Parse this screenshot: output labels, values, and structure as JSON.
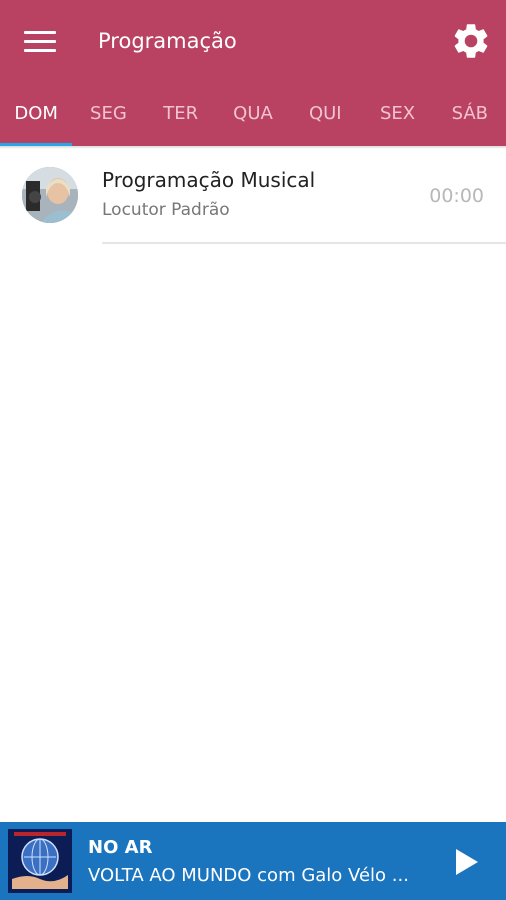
{
  "appbar": {
    "title": "Programação",
    "menu_icon": "menu-icon",
    "settings_icon": "gear-icon"
  },
  "tabs": [
    {
      "label": "DOM",
      "active": true
    },
    {
      "label": "SEG"
    },
    {
      "label": "TER"
    },
    {
      "label": "QUA"
    },
    {
      "label": "QUI"
    },
    {
      "label": "SEX"
    },
    {
      "label": "SÁB"
    }
  ],
  "schedule": [
    {
      "title": "Programação Musical",
      "host": "Locutor Padrão",
      "time": "00:00"
    }
  ],
  "player": {
    "status": "NO AR",
    "now_playing": "VOLTA AO MUNDO com Galo Vélo ...",
    "play_icon": "play-icon"
  },
  "colors": {
    "primary": "#b94262",
    "accent": "#29a6ea",
    "player_bg": "#1a74be"
  }
}
